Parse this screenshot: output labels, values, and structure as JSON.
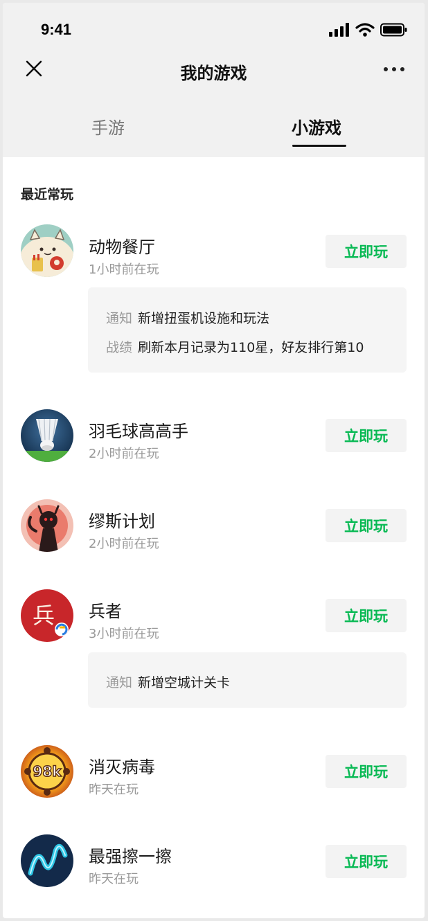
{
  "status": {
    "time": "9:41"
  },
  "nav": {
    "title": "我的游戏"
  },
  "tabs": [
    {
      "label": "手游"
    },
    {
      "label": "小游戏"
    }
  ],
  "section": {
    "title": "最近常玩"
  },
  "play_label": "立即玩",
  "games": [
    {
      "name": "动物餐厅",
      "time": "1小时前在玩",
      "notices": [
        {
          "key": "通知",
          "value": "新增扭蛋机设施和玩法"
        },
        {
          "key": "战绩",
          "value": "刷新本月记录为110星，好友排行第10"
        }
      ]
    },
    {
      "name": "羽毛球高高手",
      "time": "2小时前在玩"
    },
    {
      "name": "缪斯计划",
      "time": "2小时前在玩"
    },
    {
      "name": "兵者",
      "time": "3小时前在玩",
      "icon_text": "兵",
      "notices": [
        {
          "key": "通知",
          "value": "新增空城计关卡"
        }
      ]
    },
    {
      "name": "消灭病毒",
      "time": "昨天在玩",
      "icon_text": "98k"
    },
    {
      "name": "最强擦一擦",
      "time": "昨天在玩"
    }
  ],
  "colors": {
    "accent": "#07b953",
    "header_bg": "#f1f1f1"
  }
}
